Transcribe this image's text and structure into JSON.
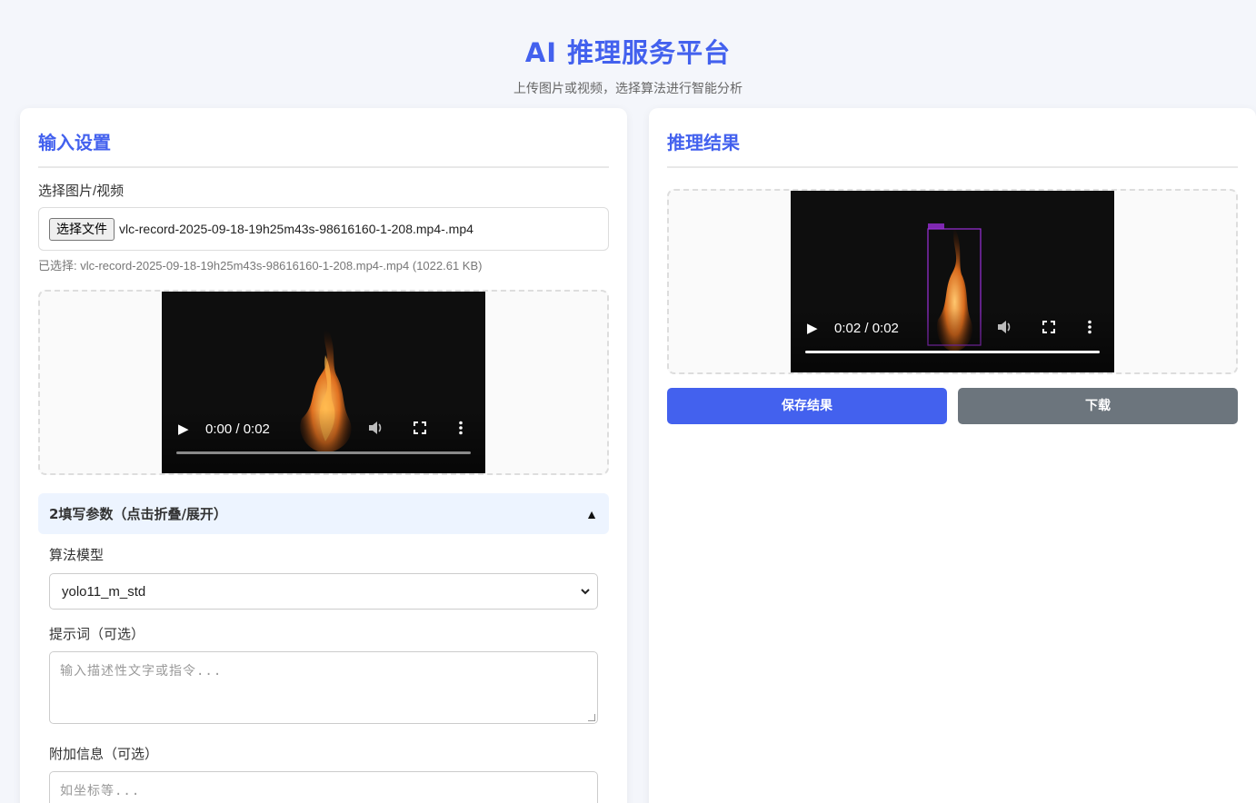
{
  "header": {
    "title": "AI 推理服务平台",
    "subtitle": "上传图片或视频，选择算法进行智能分析"
  },
  "input_panel": {
    "title": "输入设置",
    "file_label": "选择图片/视频",
    "file_button": "选择文件",
    "file_name": "vlc-record-2025-09-18-19h25m43s-98616160-1-208.mp4-.mp4",
    "file_info": "已选择: vlc-record-2025-09-18-19h25m43s-98616160-1-208.mp4-.mp4 (1022.61 KB)",
    "preview_video": {
      "time": "0:00 / 0:02",
      "progress": 0.0
    },
    "params_toggle": "2填写参数（点击折叠/展开）",
    "params_toggle_icon": "triangle-up-icon",
    "model_label": "算法模型",
    "model_value": "yolo11_m_std",
    "prompt_label": "提示词（可选）",
    "prompt_placeholder": "输入描述性文字或指令...",
    "extra_label": "附加信息（可选）",
    "extra_placeholder": "如坐标等..."
  },
  "result_panel": {
    "title": "推理结果",
    "result_video": {
      "time": "0:02 / 0:02",
      "progress": 1.0
    },
    "save_button": "保存结果",
    "download_button": "下载"
  },
  "colors": {
    "accent": "#4361ee",
    "secondary_button": "#6c757d"
  }
}
